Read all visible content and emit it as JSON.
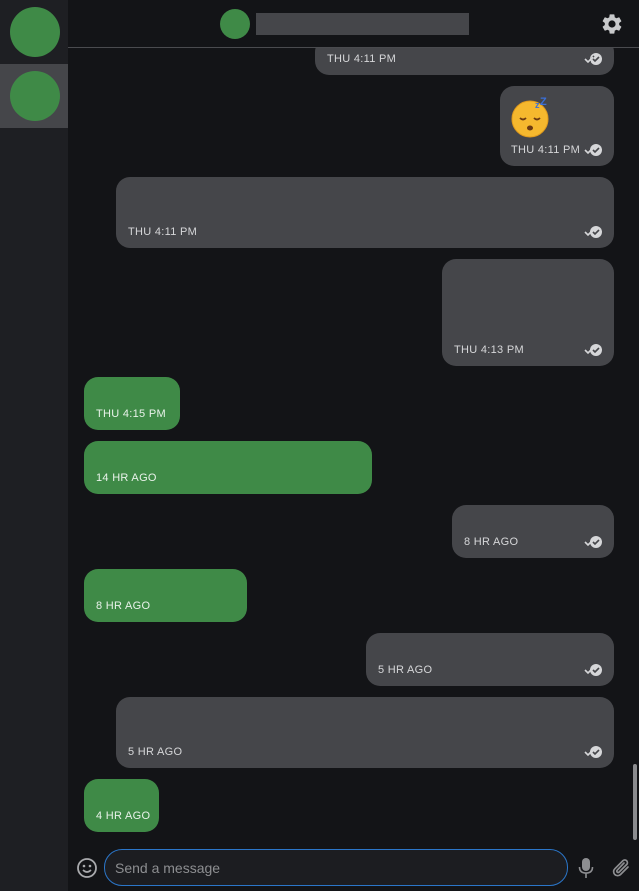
{
  "sidebar": {
    "conversations": [
      {
        "avatar_color": "#3f8a47"
      },
      {
        "avatar_color": "#3f8a47",
        "active": true
      }
    ]
  },
  "header": {
    "settings_icon": "gear-icon"
  },
  "messages": [
    {
      "direction": "outgoing",
      "timestamp": "THU 4:11 PM",
      "status_icon": "double-check-icon"
    },
    {
      "direction": "outgoing",
      "timestamp": "THU 4:11 PM",
      "emoji": "sleeping-face-emoji",
      "status_icon": "double-check-icon"
    },
    {
      "direction": "outgoing",
      "timestamp": "THU 4:11 PM",
      "status_icon": "double-check-icon"
    },
    {
      "direction": "outgoing",
      "timestamp": "THU 4:13 PM",
      "status_icon": "double-check-icon"
    },
    {
      "direction": "incoming",
      "timestamp": "THU 4:15 PM"
    },
    {
      "direction": "incoming",
      "timestamp": "14 HR AGO"
    },
    {
      "direction": "outgoing",
      "timestamp": "8 HR AGO",
      "status_icon": "double-check-icon"
    },
    {
      "direction": "incoming",
      "timestamp": "8 HR AGO"
    },
    {
      "direction": "outgoing",
      "timestamp": "5 HR AGO",
      "status_icon": "double-check-icon"
    },
    {
      "direction": "outgoing",
      "timestamp": "5 HR AGO",
      "status_icon": "double-check-icon"
    },
    {
      "direction": "incoming",
      "timestamp": "4 HR AGO"
    }
  ],
  "composer": {
    "placeholder": "Send a message",
    "value": ""
  },
  "colors": {
    "incoming_bubble": "#3f8a47",
    "outgoing_bubble": "#45464a",
    "input_focus": "#2b76c9",
    "background": "#131417"
  }
}
